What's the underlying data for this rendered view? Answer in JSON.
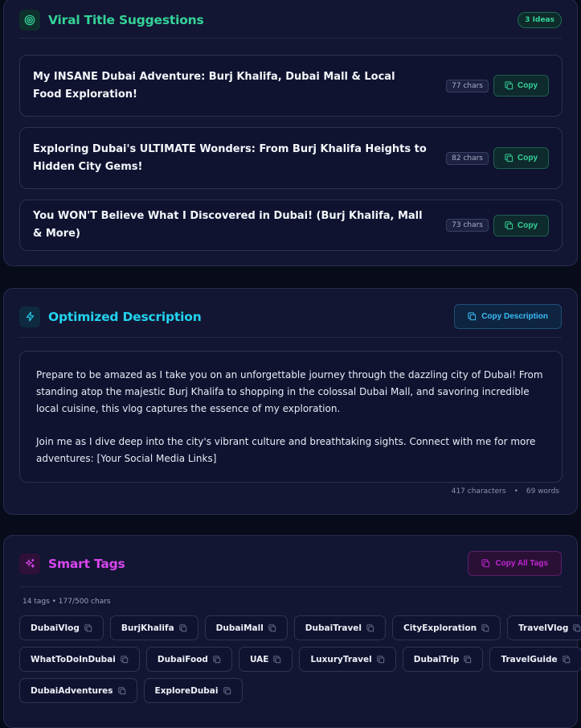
{
  "titles": {
    "heading": "Viral Title Suggestions",
    "ideas_badge": "3 Ideas",
    "accent": "#34d399",
    "items": [
      {
        "text": "My INSANE Dubai Adventure: Burj Khalifa, Dubai Mall & Local Food Exploration!",
        "chars": "77 chars",
        "copy_label": "Copy"
      },
      {
        "text": "Exploring Dubai's ULTIMATE Wonders: From Burj Khalifa Heights to Hidden City Gems!",
        "chars": "82 chars",
        "copy_label": "Copy"
      },
      {
        "text": "You WON'T Believe What I Discovered in Dubai! (Burj Khalifa, Mall & More)",
        "chars": "73 chars",
        "copy_label": "Copy"
      }
    ]
  },
  "description": {
    "heading": "Optimized Description",
    "copy_label": "Copy Description",
    "accent": "#22d3ee",
    "paragraphs": [
      "Prepare to be amazed as I take you on an unforgettable journey through the dazzling city of Dubai! From standing atop the majestic Burj Khalifa to shopping in the colossal Dubai Mall, and savoring incredible local cuisine, this vlog captures the essence of my exploration.",
      "Join me as I dive deep into the city's vibrant culture and breathtaking sights. Connect with me for more adventures: [Your Social Media Links]"
    ],
    "characters": "417 characters",
    "separator": "•",
    "words": "69 words"
  },
  "tags": {
    "heading": "Smart Tags",
    "copy_label": "Copy All Tags",
    "accent": "#d946ef",
    "meta": "14 tags • 177/500 chars",
    "rows": [
      [
        "DubaiVlog",
        "BurjKhalifa",
        "DubaiMall",
        "DubaiTravel",
        "CityExploration",
        "TravelVlog"
      ],
      [
        "WhatToDoInDubai",
        "DubaiFood",
        "UAE",
        "LuxuryTravel",
        "DubaiTrip",
        "TravelGuide"
      ],
      [
        "DubaiAdventures",
        "ExploreDubai"
      ]
    ]
  }
}
